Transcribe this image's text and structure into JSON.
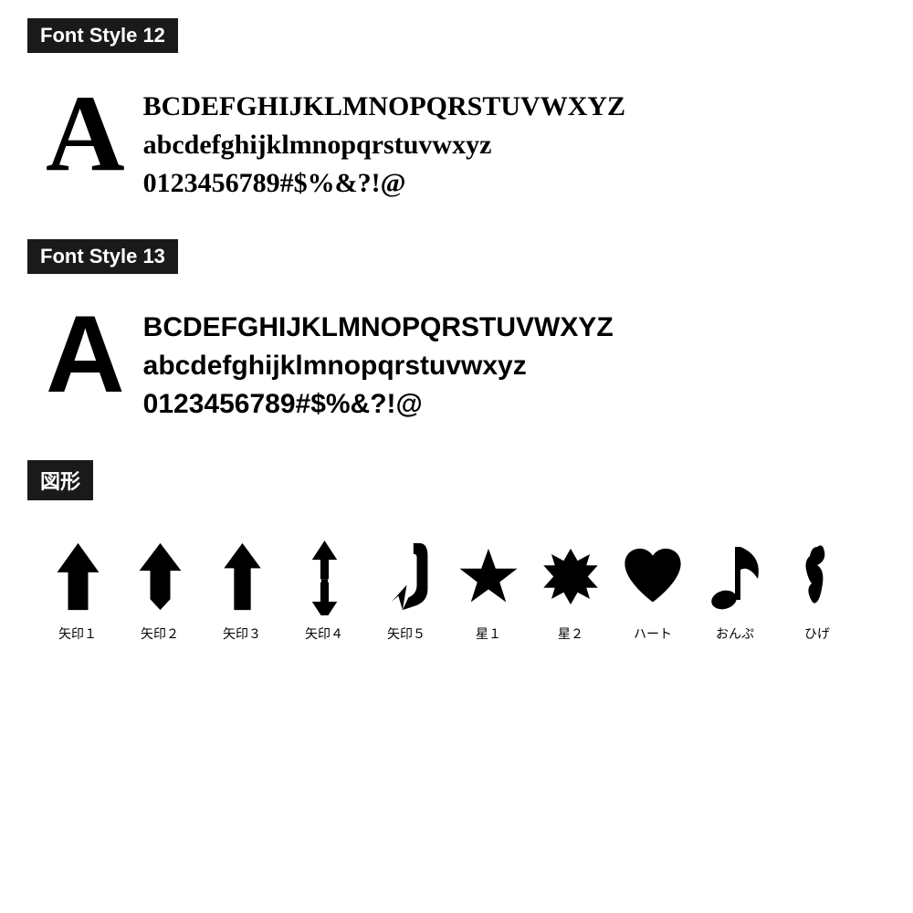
{
  "sections": [
    {
      "id": "font-style-12",
      "label": "Font Style 12",
      "big_letter": "A",
      "lines": [
        "BCDEFGHIJKLMNOPQRSTUVWXYZ",
        "abcdefghijklmnopqrstuvwxyz",
        "0123456789#$%&?!@"
      ],
      "font_type": "serif"
    },
    {
      "id": "font-style-13",
      "label": "Font Style 13",
      "big_letter": "A",
      "lines": [
        "BCDEFGHIJKLMNOPQRSTUVWXYZ",
        "abcdefghijklmnopqrstuvwxyz",
        "0123456789#$%&?!@"
      ],
      "font_type": "sans-serif"
    }
  ],
  "shapes_section": {
    "label": "図形",
    "items": [
      {
        "name": "矢印１",
        "type": "arrow1"
      },
      {
        "name": "矢印２",
        "type": "arrow2"
      },
      {
        "name": "矢印３",
        "type": "arrow3"
      },
      {
        "name": "矢印４",
        "type": "arrow4"
      },
      {
        "name": "矢印５",
        "type": "arrow5"
      },
      {
        "name": "星１",
        "type": "star1"
      },
      {
        "name": "星２",
        "type": "star2"
      },
      {
        "name": "ハート",
        "type": "heart"
      },
      {
        "name": "おんぷ",
        "type": "music"
      },
      {
        "name": "ひげ",
        "type": "mustache"
      }
    ]
  }
}
